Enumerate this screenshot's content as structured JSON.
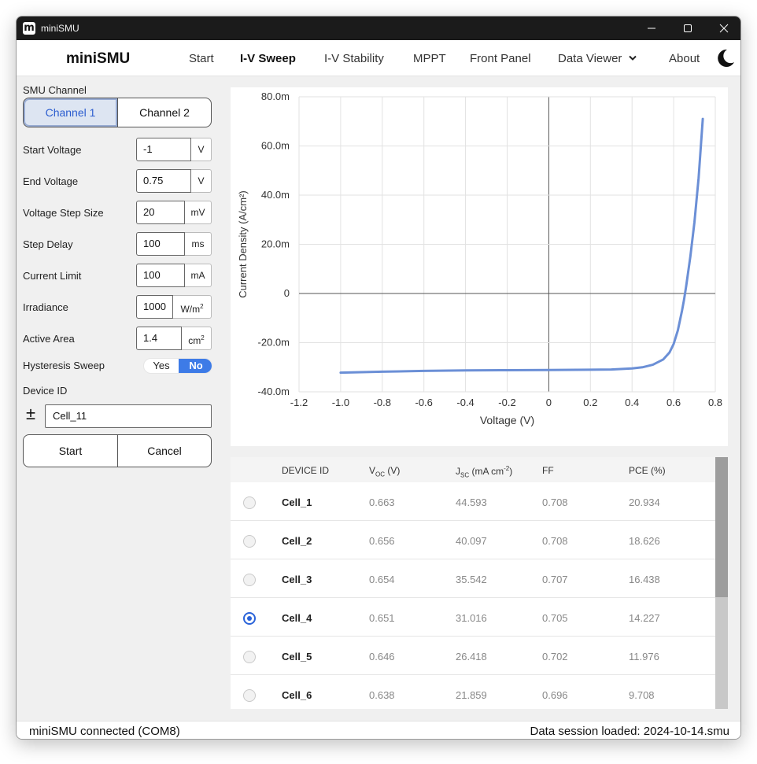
{
  "window": {
    "title": "miniSMU",
    "icon_letter": "m"
  },
  "nav": {
    "brand": "miniSMU",
    "items": [
      "Start",
      "I-V Sweep",
      "I-V Stability",
      "MPPT",
      "Front Panel",
      "Data Viewer",
      "About"
    ],
    "active": "I-V Sweep"
  },
  "form": {
    "smu_channel_label": "SMU Channel",
    "channels": [
      "Channel 1",
      "Channel 2"
    ],
    "selected_channel": "Channel 1",
    "fields": [
      {
        "label": "Start Voltage",
        "value": "-1",
        "unit": "V"
      },
      {
        "label": "End Voltage",
        "value": "0.75",
        "unit": "V"
      },
      {
        "label": "Voltage Step Size",
        "value": "20",
        "unit": "mV"
      },
      {
        "label": "Step Delay",
        "value": "100",
        "unit": "ms"
      },
      {
        "label": "Current Limit",
        "value": "100",
        "unit": "mA"
      },
      {
        "label": "Irradiance",
        "value": "1000",
        "unit": "W/m",
        "unit_sup": "2"
      },
      {
        "label": "Active Area",
        "value": "1.4",
        "unit": "cm",
        "unit_sup": "2"
      }
    ],
    "hysteresis_label": "Hysteresis Sweep",
    "hysteresis_yes": "Yes",
    "hysteresis_no": "No",
    "hysteresis_selected": "No",
    "device_id_label": "Device ID",
    "device_id_value": "Cell_11",
    "pm_symbol": "±",
    "start_label": "Start",
    "cancel_label": "Cancel"
  },
  "chart_data": {
    "type": "line",
    "xlabel": "Voltage (V)",
    "ylabel": "Current Density (A/cm²)",
    "xlim": [
      -1.2,
      0.8
    ],
    "ylim": [
      -0.04,
      0.08
    ],
    "x_ticks": [
      "-1.2",
      "-1.0",
      "-0.8",
      "-0.6",
      "-0.4",
      "-0.2",
      "0",
      "0.2",
      "0.4",
      "0.6",
      "0.8"
    ],
    "x_tick_values": [
      -1.2,
      -1.0,
      -0.8,
      -0.6,
      -0.4,
      -0.2,
      0,
      0.2,
      0.4,
      0.6,
      0.8
    ],
    "y_ticks": [
      "-40.0m",
      "-20.0m",
      "0",
      "20.0m",
      "40.0m",
      "60.0m",
      "80.0m"
    ],
    "y_tick_values": [
      -0.04,
      -0.02,
      0,
      0.02,
      0.04,
      0.06,
      0.08
    ],
    "grid": true,
    "line_color": "#6b8fd6",
    "series": [
      {
        "x": [
          -1.0,
          -0.8,
          -0.6,
          -0.4,
          -0.2,
          0.0,
          0.2,
          0.3,
          0.4,
          0.45,
          0.5,
          0.55,
          0.58,
          0.6,
          0.62,
          0.64,
          0.65,
          0.66,
          0.68,
          0.7,
          0.72,
          0.74
        ],
        "y": [
          -0.0322,
          -0.0318,
          -0.0315,
          -0.0313,
          -0.0312,
          -0.0311,
          -0.031,
          -0.0309,
          -0.0305,
          -0.03,
          -0.029,
          -0.0268,
          -0.024,
          -0.0205,
          -0.015,
          -0.007,
          -0.0025,
          0.003,
          0.015,
          0.029,
          0.047,
          0.071
        ]
      }
    ]
  },
  "table": {
    "headers": [
      "DEVICE ID",
      "V",
      "J",
      "FF",
      "PCE (%)"
    ],
    "voc_sub": "OC",
    "voc_unit": "(V)",
    "jsc_sub": "SC",
    "jsc_unit": "(mA cm",
    "jsc_sup": "-2",
    "jsc_close": ")",
    "selected_index": 3,
    "rows": [
      {
        "id": "Cell_1",
        "voc": "0.663",
        "jsc": "44.593",
        "ff": "0.708",
        "pce": "20.934"
      },
      {
        "id": "Cell_2",
        "voc": "0.656",
        "jsc": "40.097",
        "ff": "0.708",
        "pce": "18.626"
      },
      {
        "id": "Cell_3",
        "voc": "0.654",
        "jsc": "35.542",
        "ff": "0.707",
        "pce": "16.438"
      },
      {
        "id": "Cell_4",
        "voc": "0.651",
        "jsc": "31.016",
        "ff": "0.705",
        "pce": "14.227"
      },
      {
        "id": "Cell_5",
        "voc": "0.646",
        "jsc": "26.418",
        "ff": "0.702",
        "pce": "11.976"
      },
      {
        "id": "Cell_6",
        "voc": "0.638",
        "jsc": "21.859",
        "ff": "0.696",
        "pce": "9.708"
      }
    ]
  },
  "status": {
    "left": "miniSMU connected (COM8)",
    "right": "Data session loaded: 2024-10-14.smu"
  }
}
